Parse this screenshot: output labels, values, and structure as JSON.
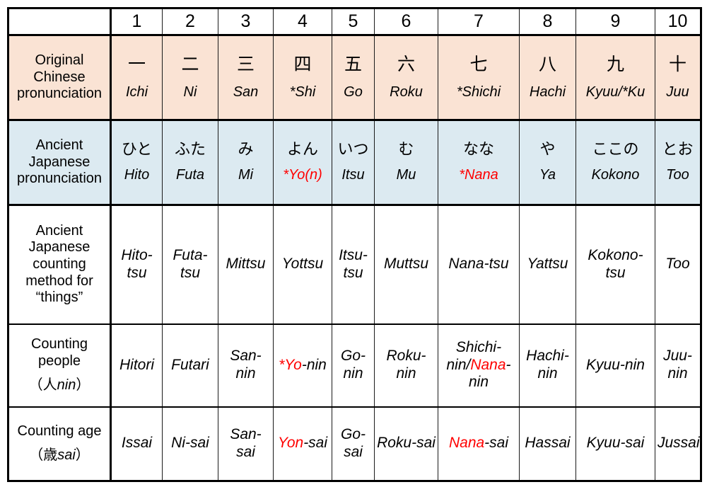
{
  "table": {
    "colors": {
      "row_original_bg": "#FAE3D4",
      "row_ancient_bg": "#DCEAF1",
      "highlight_text": "#FF0000",
      "text": "#000000",
      "border": "#000000"
    },
    "corner_label": "",
    "column_headers": [
      "1",
      "2",
      "3",
      "4",
      "5",
      "6",
      "7",
      "8",
      "9",
      "10"
    ],
    "rows": [
      {
        "key": "original-chinese-pronunciation",
        "label": "Original Chinese pronunciation",
        "label_lines": [
          "Original",
          "Chinese",
          "pronunciation"
        ],
        "cells": [
          {
            "kanji": "一",
            "romaji": "Ichi",
            "romaji_red": false
          },
          {
            "kanji": "二",
            "romaji": "Ni",
            "romaji_red": false
          },
          {
            "kanji": "三",
            "romaji": "San",
            "romaji_red": false
          },
          {
            "kanji": "四",
            "romaji": "*Shi",
            "romaji_red": false
          },
          {
            "kanji": "五",
            "romaji": "Go",
            "romaji_red": false
          },
          {
            "kanji": "六",
            "romaji": "Roku",
            "romaji_red": false
          },
          {
            "kanji": "七",
            "romaji": "*Shichi",
            "romaji_red": false
          },
          {
            "kanji": "八",
            "romaji": "Hachi",
            "romaji_red": false
          },
          {
            "kanji": "九",
            "romaji": "Kyuu/*Ku",
            "romaji_red": false
          },
          {
            "kanji": "十",
            "romaji": "Juu",
            "romaji_red": false
          }
        ]
      },
      {
        "key": "ancient-japanese-pronunciation",
        "label": "Ancient Japanese pronunciation",
        "label_lines": [
          "Ancient",
          "Japanese",
          "pronunciation"
        ],
        "cells": [
          {
            "kana": "ひと",
            "romaji": "Hito",
            "romaji_red": false
          },
          {
            "kana": "ふた",
            "romaji": "Futa",
            "romaji_red": false
          },
          {
            "kana": "み",
            "romaji": "Mi",
            "romaji_red": false
          },
          {
            "kana": "よん",
            "romaji": "*Yo(n)",
            "romaji_red": true
          },
          {
            "kana": "いつ",
            "romaji": "Itsu",
            "romaji_red": false
          },
          {
            "kana": "む",
            "romaji": "Mu",
            "romaji_red": false
          },
          {
            "kana": "なな",
            "romaji": "*Nana",
            "romaji_red": true
          },
          {
            "kana": "や",
            "romaji": "Ya",
            "romaji_red": false
          },
          {
            "kana": "ここの",
            "romaji": "Kokono",
            "romaji_red": false
          },
          {
            "kana": "とお",
            "romaji": "Too",
            "romaji_red": false
          }
        ]
      },
      {
        "key": "ancient-japanese-counting-things",
        "label": "Ancient Japanese counting method for “things”",
        "label_lines": [
          "Ancient",
          "Japanese",
          "counting",
          "method for",
          "“things”"
        ],
        "cells": [
          {
            "parts": [
              {
                "t": "Hito-tsu",
                "red": false
              }
            ]
          },
          {
            "parts": [
              {
                "t": "Futa-tsu",
                "red": false
              }
            ]
          },
          {
            "parts": [
              {
                "t": "Mittsu",
                "red": false
              }
            ]
          },
          {
            "parts": [
              {
                "t": "Yottsu",
                "red": false
              }
            ]
          },
          {
            "parts": [
              {
                "t": "Itsu-tsu",
                "red": false
              }
            ]
          },
          {
            "parts": [
              {
                "t": "Muttsu",
                "red": false
              }
            ]
          },
          {
            "parts": [
              {
                "t": "Nana-tsu",
                "red": false
              }
            ]
          },
          {
            "parts": [
              {
                "t": "Yattsu",
                "red": false
              }
            ]
          },
          {
            "parts": [
              {
                "t": "Kokono-tsu",
                "red": false
              }
            ]
          },
          {
            "parts": [
              {
                "t": "Too",
                "red": false
              }
            ]
          }
        ]
      },
      {
        "key": "counting-people",
        "label": "Counting people (人nin)",
        "label_lines": [
          "Counting",
          "people"
        ],
        "label_sub_kanji": "（人",
        "label_sub_italic": "nin",
        "label_sub_close": "）",
        "cells": [
          {
            "parts": [
              {
                "t": "Hitori",
                "red": false
              }
            ]
          },
          {
            "parts": [
              {
                "t": "Futari",
                "red": false
              }
            ]
          },
          {
            "parts": [
              {
                "t": "San-nin",
                "red": false
              }
            ]
          },
          {
            "parts": [
              {
                "t": "*Yo",
                "red": true
              },
              {
                "t": "-nin",
                "red": false
              }
            ]
          },
          {
            "parts": [
              {
                "t": "Go-nin",
                "red": false
              }
            ]
          },
          {
            "parts": [
              {
                "t": "Roku-nin",
                "red": false
              }
            ]
          },
          {
            "parts": [
              {
                "t": "Shichi-nin/",
                "red": false
              },
              {
                "t": "Nana",
                "red": true
              },
              {
                "t": "-nin",
                "red": false
              }
            ]
          },
          {
            "parts": [
              {
                "t": "Hachi-nin",
                "red": false
              }
            ]
          },
          {
            "parts": [
              {
                "t": "Kyuu-nin",
                "red": false
              }
            ]
          },
          {
            "parts": [
              {
                "t": "Juu-nin",
                "red": false
              }
            ]
          }
        ]
      },
      {
        "key": "counting-age",
        "label": "Counting age (歳sai)",
        "label_lines": [
          "Counting age"
        ],
        "label_sub_kanji": "（歳",
        "label_sub_italic": "sai",
        "label_sub_close": "）",
        "cells": [
          {
            "parts": [
              {
                "t": "Issai",
                "red": false
              }
            ]
          },
          {
            "parts": [
              {
                "t": "Ni-sai",
                "red": false
              }
            ]
          },
          {
            "parts": [
              {
                "t": "San-sai",
                "red": false
              }
            ]
          },
          {
            "parts": [
              {
                "t": "Yon",
                "red": true
              },
              {
                "t": "-sai",
                "red": false
              }
            ]
          },
          {
            "parts": [
              {
                "t": "Go-sai",
                "red": false
              }
            ]
          },
          {
            "parts": [
              {
                "t": "Roku-sai",
                "red": false
              }
            ]
          },
          {
            "parts": [
              {
                "t": "Nana",
                "red": true
              },
              {
                "t": "-sai",
                "red": false
              }
            ]
          },
          {
            "parts": [
              {
                "t": "Hassai",
                "red": false
              }
            ]
          },
          {
            "parts": [
              {
                "t": "Kyuu-sai",
                "red": false
              }
            ]
          },
          {
            "parts": [
              {
                "t": "Jussai",
                "red": false
              }
            ]
          }
        ]
      }
    ]
  }
}
